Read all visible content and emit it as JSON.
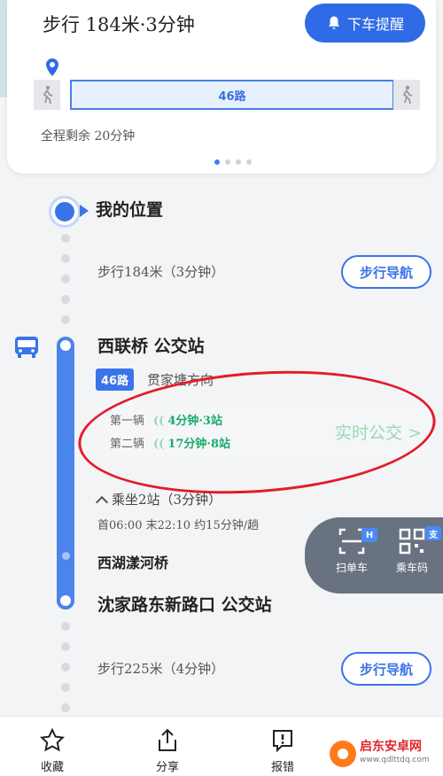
{
  "summary": {
    "walk": "步行  184米·3分钟",
    "remind_button": "下车提醒",
    "route_label": "46路",
    "remaining": "全程剩余  20分钟"
  },
  "timeline": {
    "my_location": "我的位置",
    "walk_first": "步行184米（3分钟）",
    "walk_nav_1": "步行导航",
    "board_station": "西联桥  公交站",
    "line_badge": "46路",
    "direction": "贯家塘方向",
    "bus1_label": "第一辆",
    "bus1_value": "4分钟·3站",
    "bus2_label": "第二辆",
    "bus2_value": "17分钟·8站",
    "realtime_label": "实时公交 >",
    "ride_info": "乘坐2站（3分钟）",
    "schedule": "首06:00  末22:10  约15分钟/趟",
    "mid_station": "西湖漾河桥",
    "alight_station": "沈家路东新路口  公交站",
    "walk_last": "步行225米（4分钟）",
    "walk_nav_2": "步行导航"
  },
  "float_panel": {
    "scan_label": "扫单车",
    "scan_badge": "H",
    "code_label": "乘车码",
    "code_badge": "支"
  },
  "bottom_bar": {
    "favorite": "收藏",
    "share": "分享",
    "report": "报错"
  },
  "watermark": {
    "name": "启东安卓网",
    "url": "www.qdlttdq.com"
  },
  "colors": {
    "primary": "#3b73e8",
    "realtime_green": "#1aab6b",
    "annotation_red": "#e11d2a"
  }
}
